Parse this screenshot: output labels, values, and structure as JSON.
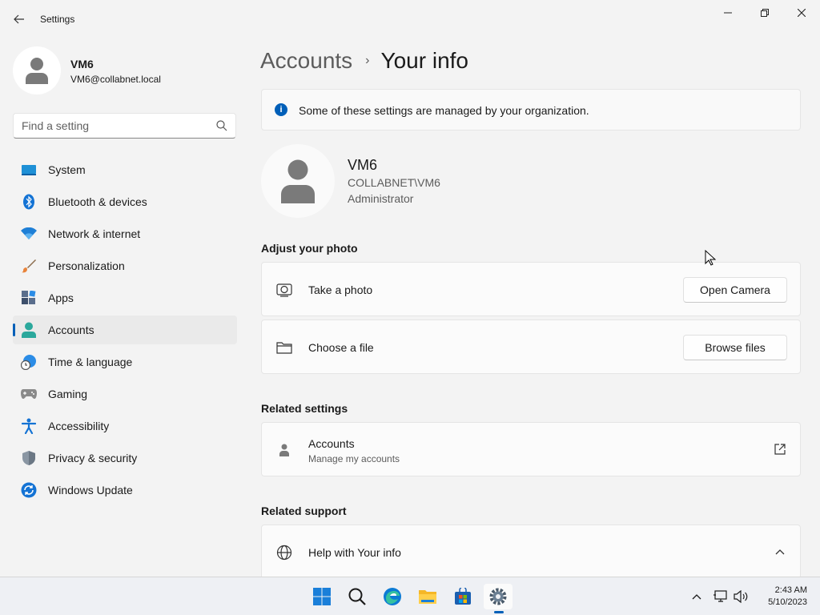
{
  "window": {
    "title": "Settings",
    "minimize_icon": "minimize-icon",
    "maximize_icon": "restore-icon",
    "close_icon": "close-icon"
  },
  "profile": {
    "name": "VM6",
    "email": "VM6@collabnet.local"
  },
  "search": {
    "placeholder": "Find a setting",
    "value": ""
  },
  "sidebar": {
    "items": [
      {
        "label": "System",
        "icon": "system-icon",
        "active": false
      },
      {
        "label": "Bluetooth & devices",
        "icon": "bluetooth-icon",
        "active": false
      },
      {
        "label": "Network & internet",
        "icon": "wifi-icon",
        "active": false
      },
      {
        "label": "Personalization",
        "icon": "brush-icon",
        "active": false
      },
      {
        "label": "Apps",
        "icon": "apps-icon",
        "active": false
      },
      {
        "label": "Accounts",
        "icon": "accounts-icon",
        "active": true
      },
      {
        "label": "Time & language",
        "icon": "globe-clock-icon",
        "active": false
      },
      {
        "label": "Gaming",
        "icon": "gamepad-icon",
        "active": false
      },
      {
        "label": "Accessibility",
        "icon": "accessibility-icon",
        "active": false
      },
      {
        "label": "Privacy & security",
        "icon": "shield-icon",
        "active": false
      },
      {
        "label": "Windows Update",
        "icon": "update-icon",
        "active": false
      }
    ]
  },
  "breadcrumb": {
    "parent": "Accounts",
    "separator": "›",
    "current": "Your info"
  },
  "info_bar": {
    "text": "Some of these settings are managed by your organization."
  },
  "user": {
    "name": "VM6",
    "domain": "COLLABNET\\VM6",
    "role": "Administrator"
  },
  "adjust_photo": {
    "title": "Adjust your photo",
    "take_photo_label": "Take a photo",
    "open_camera_label": "Open Camera",
    "choose_file_label": "Choose a file",
    "browse_files_label": "Browse files"
  },
  "related_settings": {
    "title": "Related settings",
    "accounts_label": "Accounts",
    "accounts_sub": "Manage my accounts"
  },
  "related_support": {
    "title": "Related support",
    "help_label": "Help with Your info"
  },
  "taskbar": {
    "time": "2:43 AM",
    "date": "5/10/2023"
  },
  "colors": {
    "accent": "#005fb8",
    "background": "#f3f3f3",
    "card": "#fbfbfb"
  }
}
